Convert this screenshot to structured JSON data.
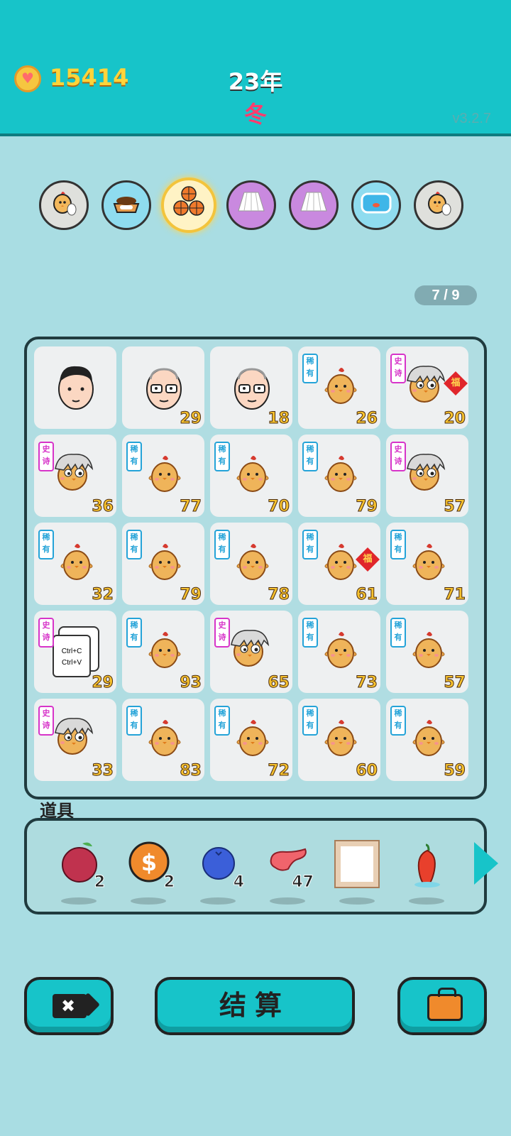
{
  "header": {
    "coins": "15414",
    "year": "23年",
    "season": "冬",
    "version": "v3.2.7",
    "coin_icon": "heart-coin-icon"
  },
  "rounds": [
    {
      "icon": "chick-egg-icon",
      "bg": "#dfe0dc"
    },
    {
      "icon": "dog-bowl-icon",
      "bg": "#8fdcef"
    },
    {
      "icon": "basketballs-icon",
      "bg": "#fff3c5"
    },
    {
      "icon": "skirt-icon",
      "bg": "#c989df"
    },
    {
      "icon": "skirt-icon",
      "bg": "#c989df"
    },
    {
      "icon": "fish-tank-icon",
      "bg": "#8fdcef"
    },
    {
      "icon": "chick-egg-icon",
      "bg": "#dfe0dc"
    }
  ],
  "counter": "7 / 9",
  "grid": [
    {
      "kind": "face-young",
      "tag": "",
      "num": "",
      "fu": false
    },
    {
      "kind": "face-old",
      "tag": "",
      "num": "29",
      "fu": false
    },
    {
      "kind": "face-old",
      "tag": "",
      "num": "18",
      "fu": false
    },
    {
      "kind": "chick",
      "tag": "稀有",
      "num": "26",
      "fu": false
    },
    {
      "kind": "chick-hair",
      "tag": "史诗",
      "num": "20",
      "fu": true
    },
    {
      "kind": "chick-hair",
      "tag": "史诗",
      "num": "36",
      "fu": false
    },
    {
      "kind": "chick",
      "tag": "稀有",
      "num": "77",
      "fu": false
    },
    {
      "kind": "chick",
      "tag": "稀有",
      "num": "70",
      "fu": false
    },
    {
      "kind": "chick",
      "tag": "稀有",
      "num": "79",
      "fu": false
    },
    {
      "kind": "chick-hair",
      "tag": "史诗",
      "num": "57",
      "fu": false
    },
    {
      "kind": "chick",
      "tag": "稀有",
      "num": "32",
      "fu": false
    },
    {
      "kind": "chick",
      "tag": "稀有",
      "num": "79",
      "fu": false
    },
    {
      "kind": "chick",
      "tag": "稀有",
      "num": "78",
      "fu": false
    },
    {
      "kind": "chick",
      "tag": "稀有",
      "num": "61",
      "fu": true
    },
    {
      "kind": "chick",
      "tag": "稀有",
      "num": "71",
      "fu": false
    },
    {
      "kind": "copy",
      "tag": "史诗",
      "num": "29",
      "fu": false
    },
    {
      "kind": "chick",
      "tag": "稀有",
      "num": "93",
      "fu": false
    },
    {
      "kind": "chick-hair",
      "tag": "史诗",
      "num": "65",
      "fu": false
    },
    {
      "kind": "chick",
      "tag": "稀有",
      "num": "73",
      "fu": false
    },
    {
      "kind": "chick",
      "tag": "稀有",
      "num": "57",
      "fu": false
    },
    {
      "kind": "chick-hair",
      "tag": "史诗",
      "num": "33",
      "fu": false
    },
    {
      "kind": "chick",
      "tag": "稀有",
      "num": "83",
      "fu": false
    },
    {
      "kind": "chick",
      "tag": "稀有",
      "num": "72",
      "fu": false
    },
    {
      "kind": "chick",
      "tag": "稀有",
      "num": "60",
      "fu": false
    },
    {
      "kind": "chick",
      "tag": "稀有",
      "num": "59",
      "fu": false
    }
  ],
  "copy_card": {
    "line1": "Ctrl+C",
    "line2": "Ctrl+V"
  },
  "fu_label": "福",
  "tools": {
    "label": "道具",
    "items": [
      {
        "icon": "lychee-icon",
        "count": "2",
        "color": "#c0324e"
      },
      {
        "icon": "dollar-coin-icon",
        "count": "2",
        "color": "#f08a2c"
      },
      {
        "icon": "blueberry-icon",
        "count": "4",
        "color": "#3b5fd9"
      },
      {
        "icon": "liver-icon",
        "count": "47",
        "color": "#f0646c"
      },
      {
        "icon": "frame-icon",
        "count": "",
        "color": "#e8cfb4"
      },
      {
        "icon": "chili-pepper-icon",
        "count": "",
        "color": "#e8402c"
      }
    ]
  },
  "buttons": {
    "cancel_icon": "close-tag-icon",
    "cancel_symbol": "✖",
    "settle": "结算",
    "bag_icon": "briefcase-icon"
  }
}
